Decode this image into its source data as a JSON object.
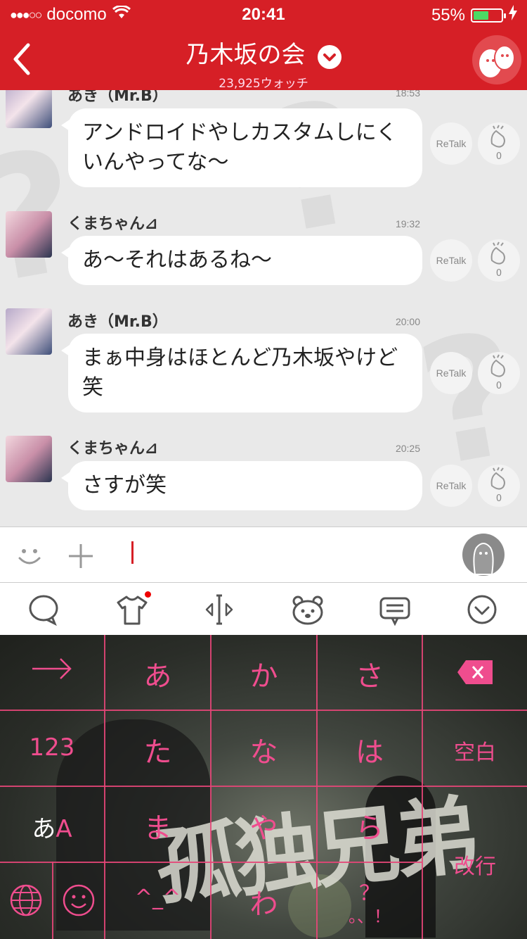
{
  "status_bar": {
    "signal_dots": "●●●○○",
    "carrier": "docomo",
    "time": "20:41",
    "battery_percent": "55%",
    "battery_level": 0.55
  },
  "nav": {
    "title": "乃木坂の会",
    "subtitle": "23,925ウォッチ"
  },
  "messages": [
    {
      "name": "あき（Mr.B）",
      "time": "18:53",
      "text": "アンドロイドやしカスタムしにくいんやってな〜",
      "retalk": "ReTalk",
      "claps": "0"
    },
    {
      "name": "くまちゃん⊿",
      "time": "19:32",
      "text": "あ〜それはあるね〜",
      "retalk": "ReTalk",
      "claps": "0"
    },
    {
      "name": "あき（Mr.B）",
      "time": "20:00",
      "text": "まぁ中身はほとんど乃木坂やけど笑",
      "retalk": "ReTalk",
      "claps": "0"
    },
    {
      "name": "くまちゃん⊿",
      "time": "20:25",
      "text": "さすが笑",
      "retalk": "ReTalk",
      "claps": "0"
    }
  ],
  "keyboard": {
    "row1": [
      "あ",
      "か",
      "さ"
    ],
    "row2": [
      "123",
      "た",
      "な",
      "は",
      "空白"
    ],
    "row3": [
      "あ",
      "A",
      "ま",
      "や",
      "ら"
    ],
    "row4": [
      "^_^",
      "わ",
      "？",
      "。、！",
      "改行"
    ],
    "wallpaper_text": "孤独兄弟"
  },
  "colors": {
    "brand_red": "#d61f26",
    "key_pink": "#ef4d8e",
    "battery_green": "#4cd964"
  }
}
